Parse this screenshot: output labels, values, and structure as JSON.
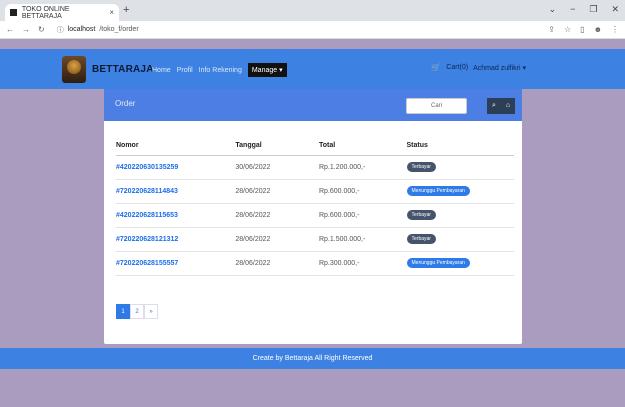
{
  "browser": {
    "tab_title": "TOKO ONLINE BETTARAJA",
    "tab_close": "×",
    "new_tab": "+",
    "url_host": "localhost",
    "url_path": "/toko_f/order"
  },
  "navbar": {
    "brand": "BETTARAJA",
    "menu": [
      "Home",
      "Profil",
      "Info Rekening"
    ],
    "manage": "Manage ▾",
    "cart": "Cart(0)",
    "user": "Achmad zulfikri ▾"
  },
  "card": {
    "title": "Order",
    "search_placeholder": "Cari"
  },
  "table": {
    "headers": [
      "Nomor",
      "Tanggal",
      "Total",
      "Status"
    ],
    "rows": [
      {
        "nomor": "#420220630135259",
        "tanggal": "30/06/2022",
        "total": "Rp.1.200.000,-",
        "status": "Terbayar",
        "type": "paid"
      },
      {
        "nomor": "#720220628114843",
        "tanggal": "28/06/2022",
        "total": "Rp.600.000,-",
        "status": "Menunggu Pembayaran",
        "type": "wait"
      },
      {
        "nomor": "#420220628115653",
        "tanggal": "28/06/2022",
        "total": "Rp.600.000,-",
        "status": "Terbayar",
        "type": "paid"
      },
      {
        "nomor": "#720220628121312",
        "tanggal": "28/06/2022",
        "total": "Rp.1.500.000,-",
        "status": "Terbayar",
        "type": "paid"
      },
      {
        "nomor": "#720220628155557",
        "tanggal": "28/06/2022",
        "total": "Rp.300.000,-",
        "status": "Menunggu Pembayaran",
        "type": "wait"
      }
    ]
  },
  "pagination": [
    "1",
    "2",
    "»"
  ],
  "footer": "Create by Bettaraja All Right Reserved",
  "colors": {
    "navbar": "#3d82e3",
    "card_header": "#4c7ee3",
    "background": "#a99cbf",
    "badge_paid": "#45536b",
    "badge_wait": "#2e7ae6"
  }
}
